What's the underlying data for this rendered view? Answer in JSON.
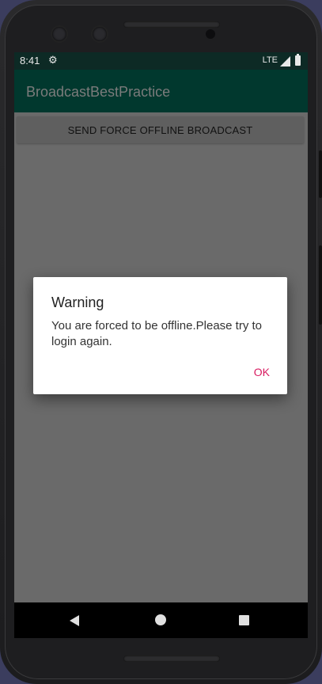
{
  "status_bar": {
    "time": "8:41",
    "network": "LTE",
    "icons": [
      "settings-gear-icon",
      "signal-icon",
      "battery-icon"
    ]
  },
  "app_bar": {
    "title": "BroadcastBestPractice"
  },
  "main": {
    "send_button_label": "SEND FORCE OFFLINE BROADCAST"
  },
  "dialog": {
    "title": "Warning",
    "message": "You are forced to be offline.Please try to login again.",
    "ok_label": "OK"
  },
  "nav_bar": {
    "icons": [
      "back-icon",
      "home-icon",
      "recents-icon"
    ]
  },
  "colors": {
    "app_bar": "#01382e",
    "status_bar": "#0d2a25",
    "dim_background": "#6a6a6a",
    "accent": "#d81b60"
  }
}
